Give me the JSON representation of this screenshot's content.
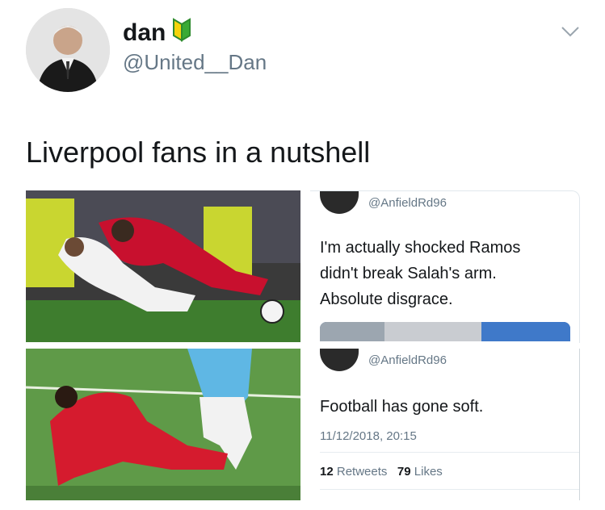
{
  "header": {
    "display_name": "dan",
    "badge_icon": "beginner-shield-icon",
    "handle": "@United__Dan",
    "menu_icon": "chevron-down-icon"
  },
  "tweet": {
    "text": "Liverpool fans in a nutshell"
  },
  "images": {
    "photo1": "tackle-photo-ramos-salah",
    "photo2": "tackle-photo-van-dijk"
  },
  "quoted_tweets": [
    {
      "handle": "@AnfieldRd96",
      "text_lines": [
        "I'm actually shocked Ramos",
        "didn't break Salah's arm.",
        "Absolute disgrace."
      ]
    },
    {
      "handle": "@AnfieldRd96",
      "text": "Football has gone soft.",
      "date": "11/12/2018, 20:15",
      "retweets_count": "12",
      "retweets_label": "Retweets",
      "likes_count": "79",
      "likes_label": "Likes"
    }
  ],
  "colors": {
    "badge_green": "#3aaa35",
    "badge_yellow": "#f5d30a",
    "text_secondary": "#657786",
    "liverpool_red": "#c8102e"
  }
}
